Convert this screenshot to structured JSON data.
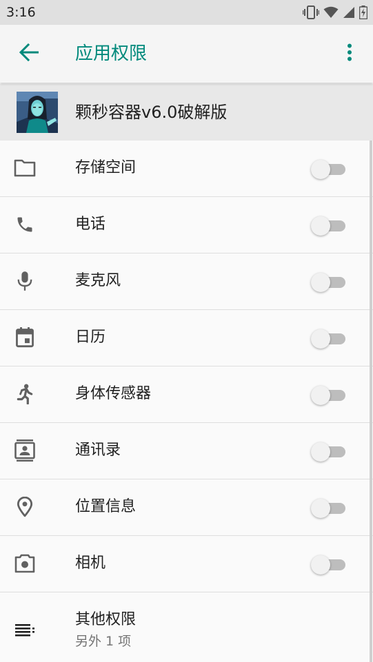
{
  "status_bar": {
    "time": "3:16",
    "icons": [
      "vibrate-icon",
      "wifi-icon",
      "signal-icon",
      "battery-charging-icon"
    ]
  },
  "app_bar": {
    "title": "应用权限",
    "back_icon": "arrow-back-icon",
    "overflow_icon": "more-vert-icon",
    "accent_color": "#00897b"
  },
  "app": {
    "name": "颗秒容器v6.0破解版"
  },
  "permissions": [
    {
      "label": "存储空间",
      "icon": "folder-icon",
      "enabled": false
    },
    {
      "label": "电话",
      "icon": "phone-icon",
      "enabled": false
    },
    {
      "label": "麦克风",
      "icon": "microphone-icon",
      "enabled": false
    },
    {
      "label": "日历",
      "icon": "calendar-icon",
      "enabled": false
    },
    {
      "label": "身体传感器",
      "icon": "body-sensor-icon",
      "enabled": false
    },
    {
      "label": "通讯录",
      "icon": "contacts-icon",
      "enabled": false
    },
    {
      "label": "位置信息",
      "icon": "location-icon",
      "enabled": false
    },
    {
      "label": "相机",
      "icon": "camera-icon",
      "enabled": false
    }
  ],
  "other_permissions": {
    "title": "其他权限",
    "subtitle": "另外 1 项",
    "icon": "list-icon"
  }
}
